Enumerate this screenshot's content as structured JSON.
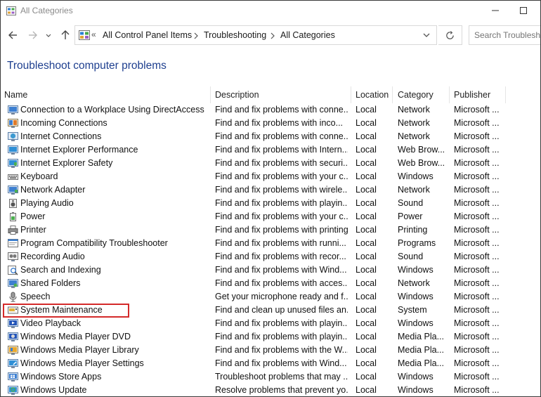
{
  "window": {
    "title": "All Categories"
  },
  "navigation": {
    "breadcrumb_prefix": "«",
    "breadcrumb": [
      "All Control Panel Items",
      "Troubleshooting",
      "All Categories"
    ],
    "search_placeholder": "Search Troubleshooting"
  },
  "page_title": "Troubleshoot computer problems",
  "columns": [
    "Name",
    "Description",
    "Location",
    "Category",
    "Publisher"
  ],
  "rows": [
    {
      "name": "Connection to a Workplace Using DirectAccess",
      "description": "Find and fix problems with conne...",
      "location": "Local",
      "category": "Network",
      "publisher": "Microsoft ...",
      "icon": "directaccess-icon"
    },
    {
      "name": "Incoming Connections",
      "description": "Find and fix problems with inco...",
      "location": "Local",
      "category": "Network",
      "publisher": "Microsoft ...",
      "icon": "incoming-connections-icon"
    },
    {
      "name": "Internet Connections",
      "description": "Find and fix problems with conne...",
      "location": "Local",
      "category": "Network",
      "publisher": "Microsoft ...",
      "icon": "internet-connections-icon"
    },
    {
      "name": "Internet Explorer Performance",
      "description": "Find and fix problems with Intern...",
      "location": "Local",
      "category": "Web Brow...",
      "publisher": "Microsoft ...",
      "icon": "ie-performance-icon"
    },
    {
      "name": "Internet Explorer Safety",
      "description": "Find and fix problems with securi...",
      "location": "Local",
      "category": "Web Brow...",
      "publisher": "Microsoft ...",
      "icon": "ie-safety-icon"
    },
    {
      "name": "Keyboard",
      "description": "Find and fix problems with your c...",
      "location": "Local",
      "category": "Windows",
      "publisher": "Microsoft ...",
      "icon": "keyboard-icon"
    },
    {
      "name": "Network Adapter",
      "description": "Find and fix problems with wirele...",
      "location": "Local",
      "category": "Network",
      "publisher": "Microsoft ...",
      "icon": "network-adapter-icon"
    },
    {
      "name": "Playing Audio",
      "description": "Find and fix problems with playin...",
      "location": "Local",
      "category": "Sound",
      "publisher": "Microsoft ...",
      "icon": "playing-audio-icon"
    },
    {
      "name": "Power",
      "description": "Find and fix problems with your c...",
      "location": "Local",
      "category": "Power",
      "publisher": "Microsoft ...",
      "icon": "power-icon"
    },
    {
      "name": "Printer",
      "description": "Find and fix problems with printing",
      "location": "Local",
      "category": "Printing",
      "publisher": "Microsoft ...",
      "icon": "printer-icon"
    },
    {
      "name": "Program Compatibility Troubleshooter",
      "description": "Find and fix problems with runni...",
      "location": "Local",
      "category": "Programs",
      "publisher": "Microsoft ...",
      "icon": "program-compatibility-icon"
    },
    {
      "name": "Recording Audio",
      "description": "Find and fix problems with recor...",
      "location": "Local",
      "category": "Sound",
      "publisher": "Microsoft ...",
      "icon": "recording-audio-icon"
    },
    {
      "name": "Search and Indexing",
      "description": "Find and fix problems with Wind...",
      "location": "Local",
      "category": "Windows",
      "publisher": "Microsoft ...",
      "icon": "search-indexing-icon"
    },
    {
      "name": "Shared Folders",
      "description": "Find and fix problems with acces...",
      "location": "Local",
      "category": "Network",
      "publisher": "Microsoft ...",
      "icon": "shared-folders-icon"
    },
    {
      "name": "Speech",
      "description": "Get your microphone ready and f...",
      "location": "Local",
      "category": "Windows",
      "publisher": "Microsoft ...",
      "icon": "microphone-icon"
    },
    {
      "name": "System Maintenance",
      "description": "Find and clean up unused files an...",
      "location": "Local",
      "category": "System",
      "publisher": "Microsoft ...",
      "icon": "system-maintenance-icon"
    },
    {
      "name": "Video Playback",
      "description": "Find and fix problems with playin...",
      "location": "Local",
      "category": "Windows",
      "publisher": "Microsoft ...",
      "icon": "video-playback-icon"
    },
    {
      "name": "Windows Media Player DVD",
      "description": "Find and fix problems with playin...",
      "location": "Local",
      "category": "Media Pla...",
      "publisher": "Microsoft ...",
      "icon": "wmp-dvd-icon"
    },
    {
      "name": "Windows Media Player Library",
      "description": "Find and fix problems with the W...",
      "location": "Local",
      "category": "Media Pla...",
      "publisher": "Microsoft ...",
      "icon": "wmp-library-icon"
    },
    {
      "name": "Windows Media Player Settings",
      "description": "Find and fix problems with Wind...",
      "location": "Local",
      "category": "Media Pla...",
      "publisher": "Microsoft ...",
      "icon": "wmp-settings-icon"
    },
    {
      "name": "Windows Store Apps",
      "description": "Troubleshoot problems that may ...",
      "location": "Local",
      "category": "Windows",
      "publisher": "Microsoft ...",
      "icon": "store-apps-icon"
    },
    {
      "name": "Windows Update",
      "description": "Resolve problems that prevent yo...",
      "location": "Local",
      "category": "Windows",
      "publisher": "Microsoft ...",
      "icon": "windows-update-icon"
    }
  ],
  "highlighted_row": "System Maintenance",
  "colors": {
    "title_blue": "#1e3f8f",
    "highlight_red": "#d42a2a"
  }
}
